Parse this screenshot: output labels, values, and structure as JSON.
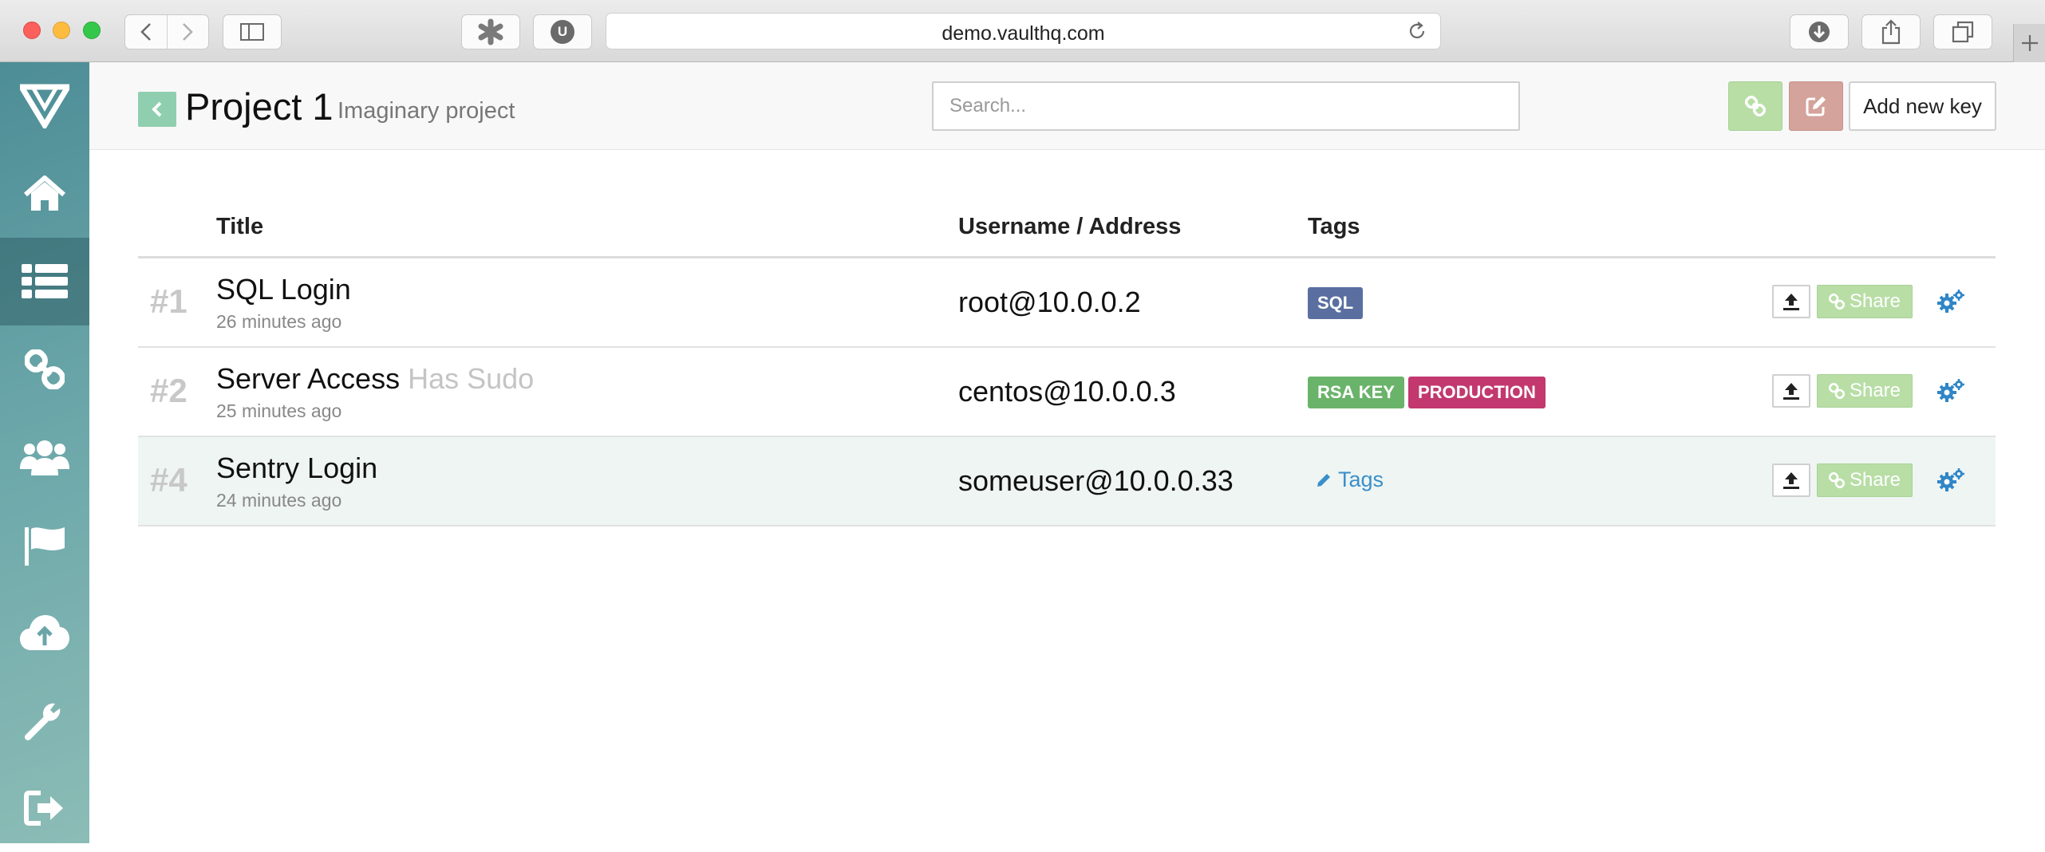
{
  "browser": {
    "url": "demo.vaulthq.com",
    "extension_badge": "U"
  },
  "sidebar": {
    "items": [
      {
        "icon": "home-icon"
      },
      {
        "icon": "list-icon",
        "active": true
      },
      {
        "icon": "link-icon"
      },
      {
        "icon": "users-icon"
      },
      {
        "icon": "flag-icon"
      },
      {
        "icon": "cloud-upload-icon"
      },
      {
        "icon": "wrench-icon"
      },
      {
        "icon": "sign-out-icon"
      }
    ]
  },
  "header": {
    "title": "Project 1",
    "subtitle": "Imaginary project",
    "search_placeholder": "Search...",
    "add_button_label": "Add new key"
  },
  "table": {
    "columns": [
      "Title",
      "Username / Address",
      "Tags"
    ],
    "rows": [
      {
        "num": "#1",
        "title": "SQL Login",
        "extra": "",
        "time": "26 minutes ago",
        "user": "root@10.0.0.2",
        "tags": [
          {
            "label": "SQL",
            "color": "#5a6fa0"
          }
        ]
      },
      {
        "num": "#2",
        "title": "Server Access",
        "extra": "Has Sudo",
        "time": "25 minutes ago",
        "user": "centos@10.0.0.3",
        "tags": [
          {
            "label": "RSA KEY",
            "color": "#6ab36a"
          },
          {
            "label": "PRODUCTION",
            "color": "#c2386f"
          }
        ]
      },
      {
        "num": "#4",
        "title": "Sentry Login",
        "extra": "",
        "time": "24 minutes ago",
        "user": "someuser@10.0.0.33",
        "tags": [],
        "tags_link": "Tags",
        "highlighted": true
      }
    ],
    "share_label": "Share"
  },
  "colors": {
    "accent_green": "#8fcfb0",
    "share_green": "#b8dea6",
    "edit_red": "#d4a39b",
    "link_blue": "#3a8fcb",
    "sidebar_teal": "#5f9ea2"
  }
}
